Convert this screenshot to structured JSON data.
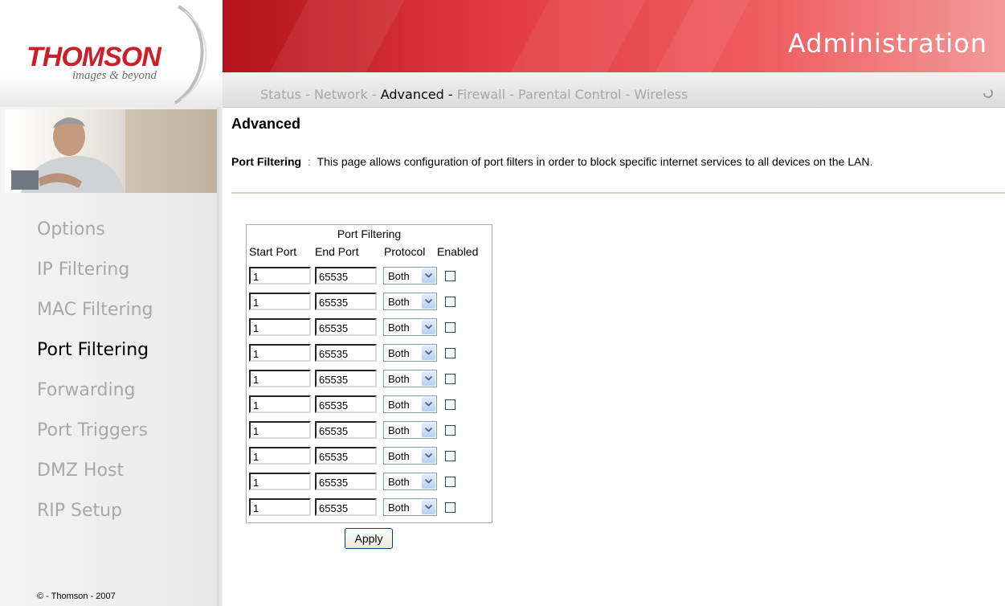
{
  "header": {
    "logo_text": "THOMSON",
    "logo_tagline": "images & beyond",
    "banner_title": "Administration",
    "brand_color": "#cc1f2a"
  },
  "nav": {
    "items": [
      {
        "label": "Status",
        "active": false
      },
      {
        "label": "Network",
        "active": false
      },
      {
        "label": "Advanced",
        "active": true
      },
      {
        "label": "Firewall",
        "active": false
      },
      {
        "label": "Parental Control",
        "active": false
      },
      {
        "label": "Wireless",
        "active": false
      }
    ],
    "separator": "-"
  },
  "sidebar": {
    "items": [
      {
        "label": "Options",
        "active": false
      },
      {
        "label": "IP Filtering",
        "active": false
      },
      {
        "label": "MAC Filtering",
        "active": false
      },
      {
        "label": "Port Filtering",
        "active": true
      },
      {
        "label": "Forwarding",
        "active": false
      },
      {
        "label": "Port Triggers",
        "active": false
      },
      {
        "label": "DMZ Host",
        "active": false
      },
      {
        "label": "RIP Setup",
        "active": false
      }
    ],
    "copyright": "© - Thomson - 2007"
  },
  "main": {
    "title": "Advanced",
    "description_label": "Port Filtering",
    "description_sep": ":",
    "description_text": "This page allows configuration of port filters in order to block specific internet services to all devices on the LAN.",
    "table": {
      "caption": "Port Filtering",
      "headers": [
        "Start Port",
        "End Port",
        "Protocol",
        "Enabled"
      ],
      "rows": [
        {
          "start": "1",
          "end": "65535",
          "protocol": "Both",
          "enabled": false
        },
        {
          "start": "1",
          "end": "65535",
          "protocol": "Both",
          "enabled": false
        },
        {
          "start": "1",
          "end": "65535",
          "protocol": "Both",
          "enabled": false
        },
        {
          "start": "1",
          "end": "65535",
          "protocol": "Both",
          "enabled": false
        },
        {
          "start": "1",
          "end": "65535",
          "protocol": "Both",
          "enabled": false
        },
        {
          "start": "1",
          "end": "65535",
          "protocol": "Both",
          "enabled": false
        },
        {
          "start": "1",
          "end": "65535",
          "protocol": "Both",
          "enabled": false
        },
        {
          "start": "1",
          "end": "65535",
          "protocol": "Both",
          "enabled": false
        },
        {
          "start": "1",
          "end": "65535",
          "protocol": "Both",
          "enabled": false
        },
        {
          "start": "1",
          "end": "65535",
          "protocol": "Both",
          "enabled": false
        }
      ]
    },
    "apply_label": "Apply"
  }
}
